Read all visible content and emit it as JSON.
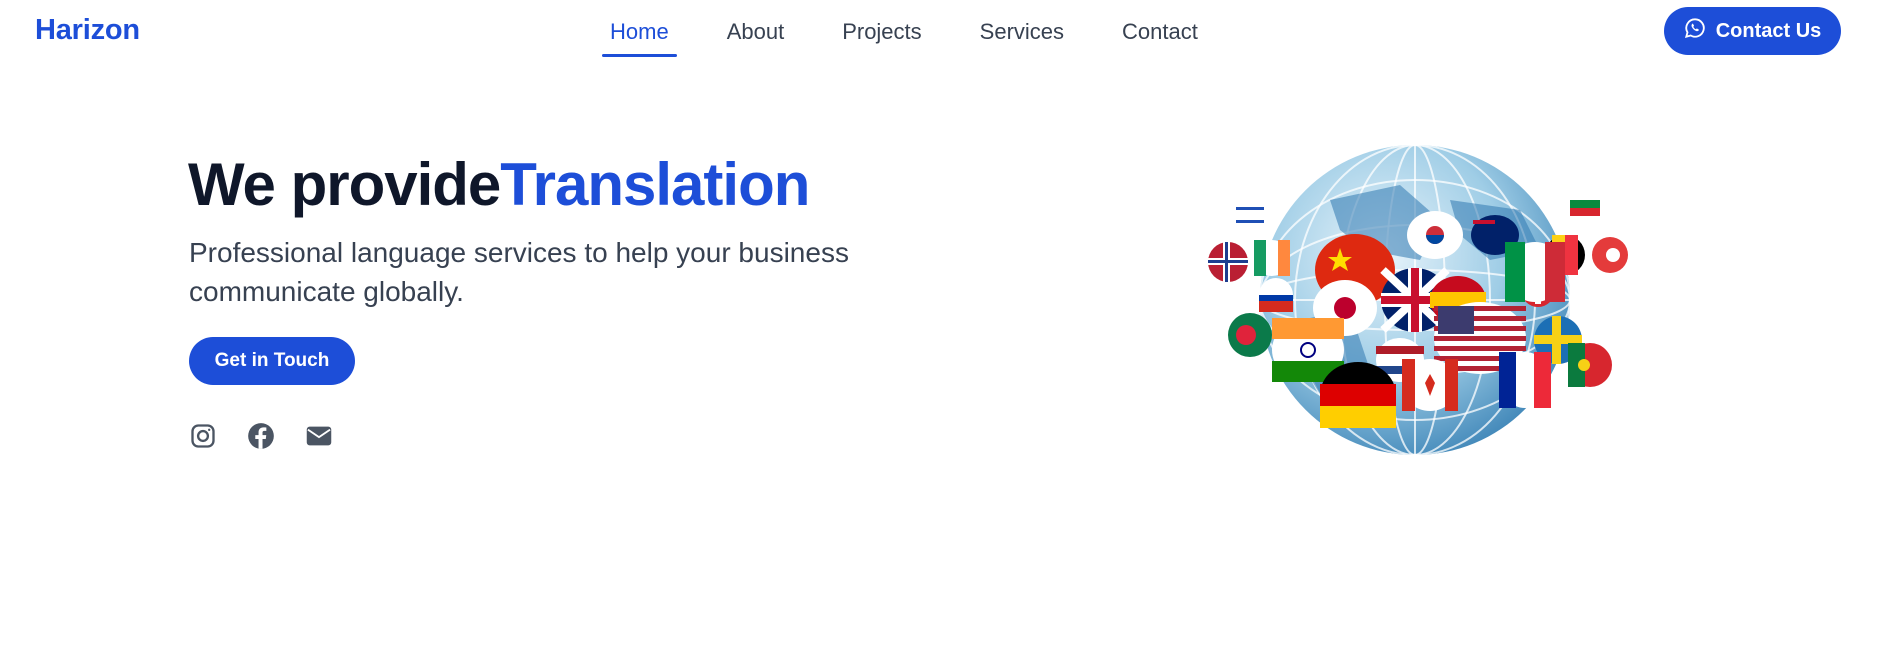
{
  "brand": {
    "name": "Harizon"
  },
  "nav": {
    "items": [
      {
        "label": "Home",
        "active": true
      },
      {
        "label": "About",
        "active": false
      },
      {
        "label": "Projects",
        "active": false
      },
      {
        "label": "Services",
        "active": false
      },
      {
        "label": "Contact",
        "active": false
      }
    ]
  },
  "header_cta": {
    "label": "Contact Us",
    "icon": "whatsapp-icon"
  },
  "hero": {
    "title_prefix": "We provide",
    "title_accent": "Translation",
    "subtitle": "Professional language services to help your business communicate globally.",
    "cta_label": "Get in Touch"
  },
  "socials": [
    {
      "icon": "instagram-icon"
    },
    {
      "icon": "facebook-icon"
    },
    {
      "icon": "email-icon"
    }
  ],
  "illustration": {
    "icon": "globe-with-flags-illustration"
  },
  "colors": {
    "accent": "#1d4ed8",
    "heading": "#0f172a",
    "body_text": "#374151",
    "icon_gray": "#4b5563",
    "background": "#ffffff"
  }
}
